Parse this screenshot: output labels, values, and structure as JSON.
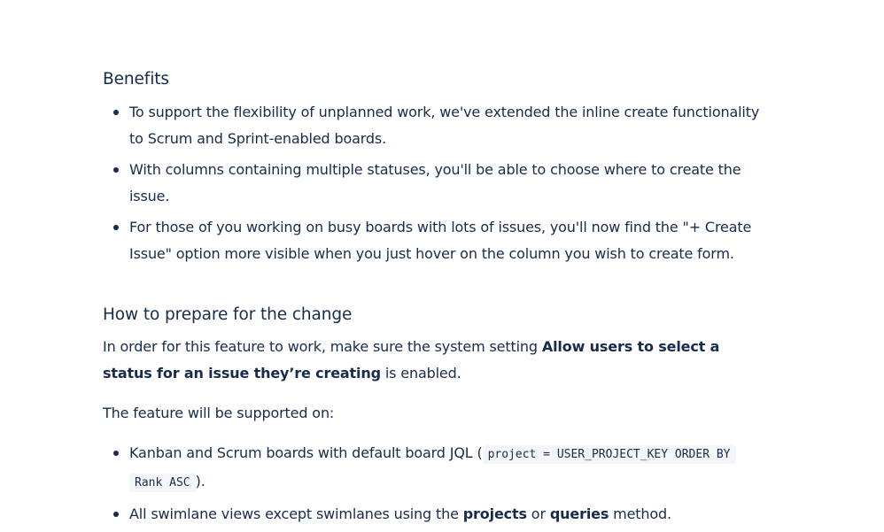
{
  "benefits": {
    "heading": "Benefits",
    "items": [
      "To support the flexibility of unplanned work, we've extended the inline create functionality to Scrum and Sprint-enabled boards.",
      "With columns containing multiple statuses, you'll be able to choose where to create the issue.",
      "For those of you working on busy boards with lots of issues, you'll now find the \"+ Create Issue\" option more visible when you just hover on the column you wish to create form."
    ]
  },
  "prepare": {
    "heading": "How to prepare for the change",
    "intro_before": "In order for this feature to work, make sure the system setting ",
    "intro_setting": "Allow users to select a status for an issue they’re creating",
    "intro_after": " is enabled.",
    "supported_on": "The feature will be supported on:",
    "item1_before": "Kanban and Scrum boards with default board JQL (",
    "item1_code": "project = USER_PROJECT_KEY ORDER BY Rank ASC",
    "item1_after": ").",
    "item2_before": "All swimlane views except swimlanes using the ",
    "item2_bold1": "projects",
    "item2_middle": " or ",
    "item2_bold2": "queries",
    "item2_after": " method."
  }
}
